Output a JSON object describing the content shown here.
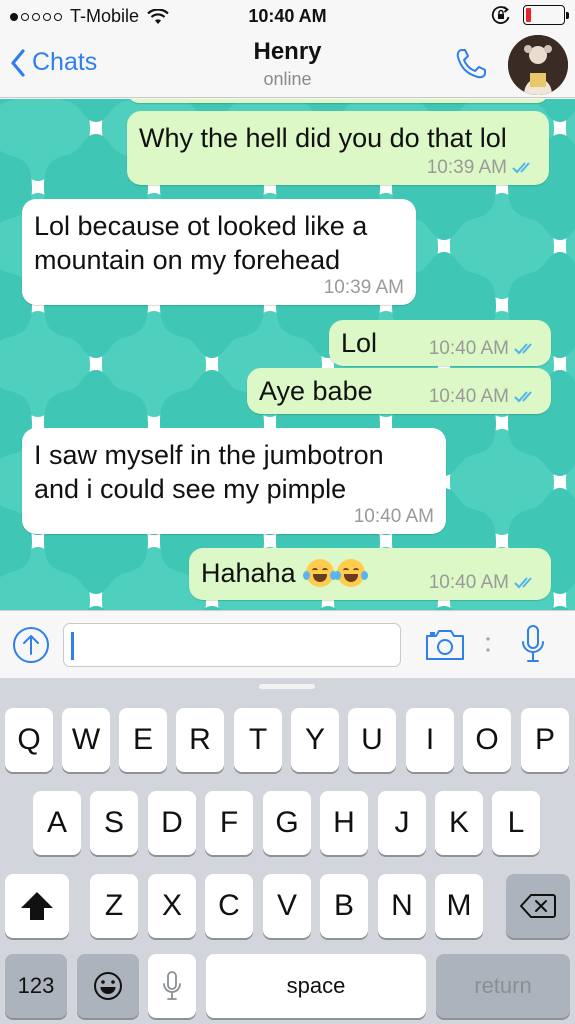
{
  "status_bar": {
    "carrier": "T-Mobile",
    "time": "10:40 AM",
    "battery_level": 0.15,
    "signal_dots_filled": 1,
    "signal_dots_total": 5
  },
  "nav": {
    "back_label": "Chats",
    "contact_name": "Henry",
    "contact_status": "online"
  },
  "messages": [
    {
      "dir": "out",
      "text": "Why the hell did you do that lol",
      "time": "10:39 AM",
      "read": true
    },
    {
      "dir": "in",
      "text_lines": [
        "Lol because ot looked like a",
        "mountain on my forehead"
      ],
      "time": "10:39 AM"
    },
    {
      "dir": "out",
      "text": "Lol",
      "time": "10:40 AM",
      "read": true
    },
    {
      "dir": "out",
      "text": "Aye babe",
      "time": "10:40 AM",
      "read": true
    },
    {
      "dir": "in",
      "text_lines": [
        "I saw myself in the jumbotron",
        "and i could see my pimple"
      ],
      "time": "10:40 AM"
    },
    {
      "dir": "out",
      "text": "Hahaha",
      "emoji": [
        "face-with-tears-of-joy",
        "face-with-tears-of-joy"
      ],
      "time": "10:40 AM",
      "read": true
    }
  ],
  "input": {
    "value": "",
    "icons": [
      "upload-icon",
      "camera-icon",
      "microphone-icon"
    ]
  },
  "keyboard": {
    "row1": [
      "Q",
      "W",
      "E",
      "R",
      "T",
      "Y",
      "U",
      "I",
      "O",
      "P"
    ],
    "row2": [
      "A",
      "S",
      "D",
      "F",
      "G",
      "H",
      "J",
      "K",
      "L"
    ],
    "row3": [
      "Z",
      "X",
      "C",
      "V",
      "B",
      "N",
      "M"
    ],
    "numbers_label": "123",
    "space_label": "space",
    "return_label": "return"
  },
  "colors": {
    "accent": "#2f80ed",
    "outgoing_bubble": "#dcf8c6",
    "incoming_bubble": "#ffffff",
    "read_ticks": "#4fb6ec",
    "wallpaper": "#5fd2c2"
  }
}
